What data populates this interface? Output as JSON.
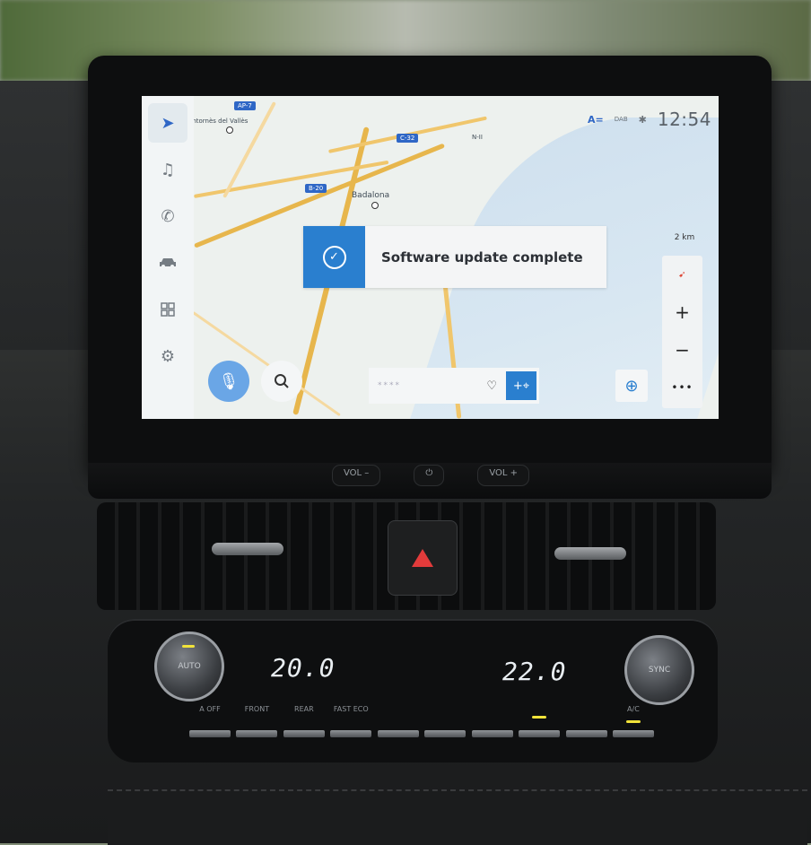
{
  "status_bar": {
    "clock": "12:54",
    "lang_icon": "A=",
    "dab_label": "DAB",
    "bluetooth_icon": "bluetooth-icon"
  },
  "sidebar": {
    "items": [
      {
        "name": "navigation",
        "icon": "navigation-arrow-icon",
        "active": true
      },
      {
        "name": "music",
        "icon": "music-note-icon",
        "active": false
      },
      {
        "name": "phone",
        "icon": "phone-icon",
        "active": false
      },
      {
        "name": "vehicle",
        "icon": "car-icon",
        "active": false
      },
      {
        "name": "apps",
        "icon": "apps-grid-icon",
        "active": false
      },
      {
        "name": "settings",
        "icon": "gear-icon",
        "active": false
      }
    ]
  },
  "map": {
    "labels": {
      "city": "Badalona",
      "town": "Montornès del Vallès",
      "highway_b20": "B-20",
      "highway_c32": "C-32",
      "highway_top": "AP-7",
      "road_n2": "N-II"
    },
    "scale": "2 km"
  },
  "toast": {
    "message": "Software update complete",
    "icon": "check-circle-icon"
  },
  "controls": {
    "zoom_in": "+",
    "zoom_out": "−",
    "more": "•••",
    "compass_icon": "compass-icon"
  },
  "bottom_bar": {
    "voice_icon": "microphone-icon",
    "search_icon": "search-icon",
    "destination_placeholder": "****",
    "favorite_icon": "heart-icon",
    "add_destination_icon": "add-location-icon",
    "recenter_icon": "recenter-icon"
  },
  "hardware": {
    "vol_down": "VOL –",
    "power": "⏻",
    "vol_up": "VOL +"
  },
  "climate": {
    "left_temp": "20.0",
    "right_temp": "22.0",
    "left_knob": "AUTO",
    "right_knob": "SYNC",
    "buttons": [
      {
        "label": "A OFF",
        "led": false
      },
      {
        "label": "FRONT",
        "led": false
      },
      {
        "label": "REAR",
        "led": false
      },
      {
        "label": "FAST ECO",
        "led": false
      },
      {
        "label": "",
        "led": false
      },
      {
        "label": "",
        "led": false
      },
      {
        "label": "",
        "led": false
      },
      {
        "label": "",
        "led": true
      },
      {
        "label": "",
        "led": false
      },
      {
        "label": "A/C",
        "led": true
      }
    ],
    "accent_led": "#f1e33a"
  },
  "colors": {
    "accent_blue": "#2a7fcf",
    "mic_blue": "#6aa6e6",
    "hazard_red": "#e23b3b"
  }
}
